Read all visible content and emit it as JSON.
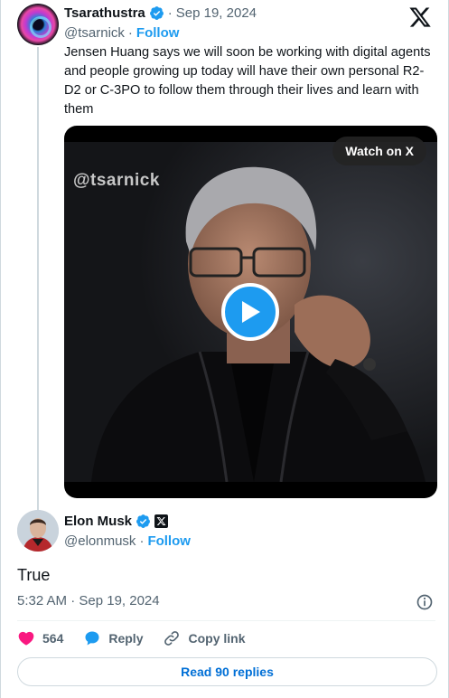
{
  "quoted_tweet": {
    "author_name": "Tsarathustra",
    "date": "Sep 19, 2024",
    "handle": "@tsarnick",
    "follow_label": "Follow",
    "text": "Jensen Huang says we will soon be working with digital agents and people growing up today will have their own personal R2-D2 or C-3PO to follow them through their lives and learn with them",
    "video": {
      "watermark": "@tsarnick",
      "watch_label": "Watch on X"
    }
  },
  "main_tweet": {
    "author_name": "Elon Musk",
    "handle": "@elonmusk",
    "follow_label": "Follow",
    "text": "True",
    "timestamp": "5:32 AM · Sep 19, 2024"
  },
  "actions": {
    "like_count": "564",
    "reply_label": "Reply",
    "copy_label": "Copy link"
  },
  "read_replies_label": "Read 90 replies",
  "separator": "·",
  "colors": {
    "accent": "#1d9bf0",
    "like": "#f91880",
    "link": "#006fd6",
    "muted": "#536471"
  }
}
